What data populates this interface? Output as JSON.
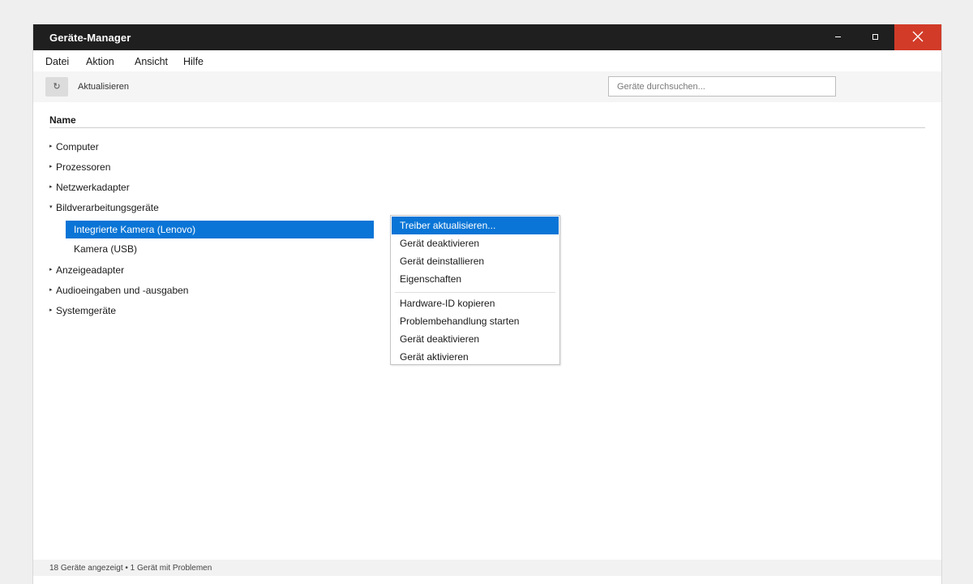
{
  "window": {
    "title": "Geräte-Manager",
    "controls": {
      "minimize": "minimize-icon",
      "maximize": "maximize-icon",
      "close": "close-icon"
    },
    "close_color": "#d13b28"
  },
  "menubar": {
    "items": [
      "Datei",
      "Aktion",
      "Ansicht",
      "Hilfe"
    ]
  },
  "toolbar": {
    "refresh_icon": "↻",
    "refresh_label": "Aktualisieren",
    "search_placeholder": "Geräte durchsuchen...",
    "search_value": ""
  },
  "list": {
    "column_header": "Name",
    "categories": [
      {
        "label": "Computer",
        "expanded": false
      },
      {
        "label": "Prozessoren",
        "expanded": false
      },
      {
        "label": "Netzwerkadapter",
        "expanded": false
      },
      {
        "label": "Bildverarbeitungsgeräte",
        "expanded": true,
        "children": [
          {
            "label": "Integrierte Kamera (Lenovo)",
            "selected": true
          },
          {
            "label": "Kamera (USB)",
            "selected": false
          }
        ]
      },
      {
        "label": "Anzeigeadapter",
        "expanded": false
      },
      {
        "label": "Audioeingaben und -ausgaben",
        "expanded": false
      },
      {
        "label": "Systemgeräte",
        "expanded": false
      }
    ],
    "collapsed_marker": "▸",
    "expanded_marker": "▾"
  },
  "context_menu": {
    "items": [
      "Treiber aktualisieren...",
      "Gerät deaktivieren",
      "Gerät deinstallieren",
      "Eigenschaften",
      "Hardware-ID kopieren",
      "Problembehandlung starten",
      "Gerät deaktivieren",
      "Gerät aktivieren"
    ],
    "highlighted_index": 0
  },
  "statusbar": {
    "text": "18 Geräte angezeigt • 1 Gerät mit Problemen"
  },
  "colors": {
    "selection": "#0a75d6",
    "titlebar": "#1f1f1f"
  }
}
